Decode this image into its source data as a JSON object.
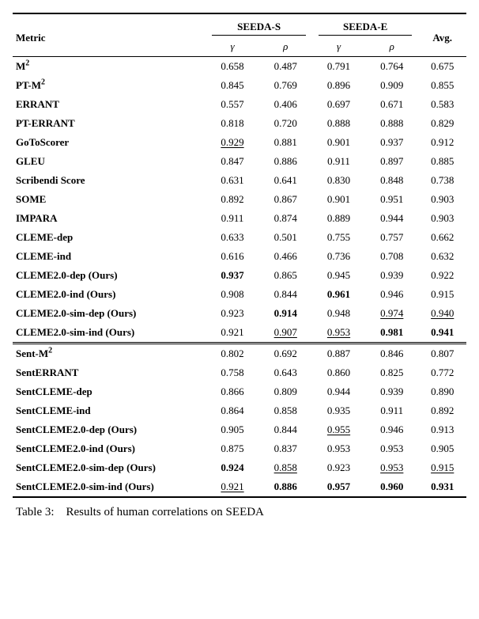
{
  "header": {
    "metric_label": "Metric",
    "group_s": "SEEDA-S",
    "group_e": "SEEDA-E",
    "avg": "Avg.",
    "gamma": "γ",
    "rho": "ρ"
  },
  "groupA": [
    {
      "name_html": "M<sup>2</sup>",
      "vals": [
        {
          "t": "0.658"
        },
        {
          "t": "0.487"
        },
        {
          "t": "0.791"
        },
        {
          "t": "0.764"
        },
        {
          "t": "0.675"
        }
      ]
    },
    {
      "name_html": "PT-M<sup>2</sup>",
      "vals": [
        {
          "t": "0.845"
        },
        {
          "t": "0.769"
        },
        {
          "t": "0.896"
        },
        {
          "t": "0.909"
        },
        {
          "t": "0.855"
        }
      ]
    },
    {
      "name_html": "ERRANT",
      "vals": [
        {
          "t": "0.557"
        },
        {
          "t": "0.406"
        },
        {
          "t": "0.697"
        },
        {
          "t": "0.671"
        },
        {
          "t": "0.583"
        }
      ]
    },
    {
      "name_html": "PT-ERRANT",
      "vals": [
        {
          "t": "0.818"
        },
        {
          "t": "0.720"
        },
        {
          "t": "0.888"
        },
        {
          "t": "0.888"
        },
        {
          "t": "0.829"
        }
      ]
    },
    {
      "name_html": "GoToScorer",
      "vals": [
        {
          "t": "0.929",
          "u": true
        },
        {
          "t": "0.881"
        },
        {
          "t": "0.901"
        },
        {
          "t": "0.937"
        },
        {
          "t": "0.912"
        }
      ]
    },
    {
      "name_html": "GLEU",
      "vals": [
        {
          "t": "0.847"
        },
        {
          "t": "0.886"
        },
        {
          "t": "0.911"
        },
        {
          "t": "0.897"
        },
        {
          "t": "0.885"
        }
      ]
    },
    {
      "name_html": "Scribendi Score",
      "vals": [
        {
          "t": "0.631"
        },
        {
          "t": "0.641"
        },
        {
          "t": "0.830"
        },
        {
          "t": "0.848"
        },
        {
          "t": "0.738"
        }
      ]
    },
    {
      "name_html": "SOME",
      "vals": [
        {
          "t": "0.892"
        },
        {
          "t": "0.867"
        },
        {
          "t": "0.901"
        },
        {
          "t": "0.951"
        },
        {
          "t": "0.903"
        }
      ]
    },
    {
      "name_html": "IMPARA",
      "vals": [
        {
          "t": "0.911"
        },
        {
          "t": "0.874"
        },
        {
          "t": "0.889"
        },
        {
          "t": "0.944"
        },
        {
          "t": "0.903"
        }
      ]
    },
    {
      "name_html": "CLEME-dep",
      "vals": [
        {
          "t": "0.633"
        },
        {
          "t": "0.501"
        },
        {
          "t": "0.755"
        },
        {
          "t": "0.757"
        },
        {
          "t": "0.662"
        }
      ]
    },
    {
      "name_html": "CLEME-ind",
      "vals": [
        {
          "t": "0.616"
        },
        {
          "t": "0.466"
        },
        {
          "t": "0.736"
        },
        {
          "t": "0.708"
        },
        {
          "t": "0.632"
        }
      ]
    },
    {
      "name_html": "CLEME2.0-dep (Ours)",
      "vals": [
        {
          "t": "0.937",
          "b": true
        },
        {
          "t": "0.865"
        },
        {
          "t": "0.945"
        },
        {
          "t": "0.939"
        },
        {
          "t": "0.922"
        }
      ]
    },
    {
      "name_html": "CLEME2.0-ind (Ours)",
      "vals": [
        {
          "t": "0.908"
        },
        {
          "t": "0.844"
        },
        {
          "t": "0.961",
          "b": true
        },
        {
          "t": "0.946"
        },
        {
          "t": "0.915"
        }
      ]
    },
    {
      "name_html": "CLEME2.0-sim-dep (Ours)",
      "vals": [
        {
          "t": "0.923"
        },
        {
          "t": "0.914",
          "b": true
        },
        {
          "t": "0.948"
        },
        {
          "t": "0.974",
          "u": true
        },
        {
          "t": "0.940",
          "u": true
        }
      ]
    },
    {
      "name_html": "CLEME2.0-sim-ind (Ours)",
      "vals": [
        {
          "t": "0.921"
        },
        {
          "t": "0.907",
          "u": true
        },
        {
          "t": "0.953",
          "u": true
        },
        {
          "t": "0.981",
          "b": true
        },
        {
          "t": "0.941",
          "b": true
        }
      ]
    }
  ],
  "groupB": [
    {
      "name_html": "Sent-M<sup>2</sup>",
      "vals": [
        {
          "t": "0.802"
        },
        {
          "t": "0.692"
        },
        {
          "t": "0.887"
        },
        {
          "t": "0.846"
        },
        {
          "t": "0.807"
        }
      ]
    },
    {
      "name_html": "SentERRANT",
      "vals": [
        {
          "t": "0.758"
        },
        {
          "t": "0.643"
        },
        {
          "t": "0.860"
        },
        {
          "t": "0.825"
        },
        {
          "t": "0.772"
        }
      ]
    },
    {
      "name_html": "SentCLEME-dep",
      "vals": [
        {
          "t": "0.866"
        },
        {
          "t": "0.809"
        },
        {
          "t": "0.944"
        },
        {
          "t": "0.939"
        },
        {
          "t": "0.890"
        }
      ]
    },
    {
      "name_html": "SentCLEME-ind",
      "vals": [
        {
          "t": "0.864"
        },
        {
          "t": "0.858"
        },
        {
          "t": "0.935"
        },
        {
          "t": "0.911"
        },
        {
          "t": "0.892"
        }
      ]
    },
    {
      "name_html": "SentCLEME2.0-dep (Ours)",
      "vals": [
        {
          "t": "0.905"
        },
        {
          "t": "0.844"
        },
        {
          "t": "0.955",
          "u": true
        },
        {
          "t": "0.946"
        },
        {
          "t": "0.913"
        }
      ]
    },
    {
      "name_html": "SentCLEME2.0-ind (Ours)",
      "vals": [
        {
          "t": "0.875"
        },
        {
          "t": "0.837"
        },
        {
          "t": "0.953"
        },
        {
          "t": "0.953"
        },
        {
          "t": "0.905"
        }
      ]
    },
    {
      "name_html": "SentCLEME2.0-sim-dep (Ours)",
      "vals": [
        {
          "t": "0.924",
          "b": true
        },
        {
          "t": "0.858",
          "u": true
        },
        {
          "t": "0.923"
        },
        {
          "t": "0.953",
          "u": true
        },
        {
          "t": "0.915",
          "u": true
        }
      ]
    },
    {
      "name_html": "SentCLEME2.0-sim-ind (Ours)",
      "vals": [
        {
          "t": "0.921",
          "u": true
        },
        {
          "t": "0.886",
          "b": true
        },
        {
          "t": "0.957",
          "b": true
        },
        {
          "t": "0.960",
          "b": true
        },
        {
          "t": "0.931",
          "b": true
        }
      ]
    }
  ],
  "caption_prefix": "Table 3:",
  "caption_rest": "Results of human correlations on SEEDA"
}
